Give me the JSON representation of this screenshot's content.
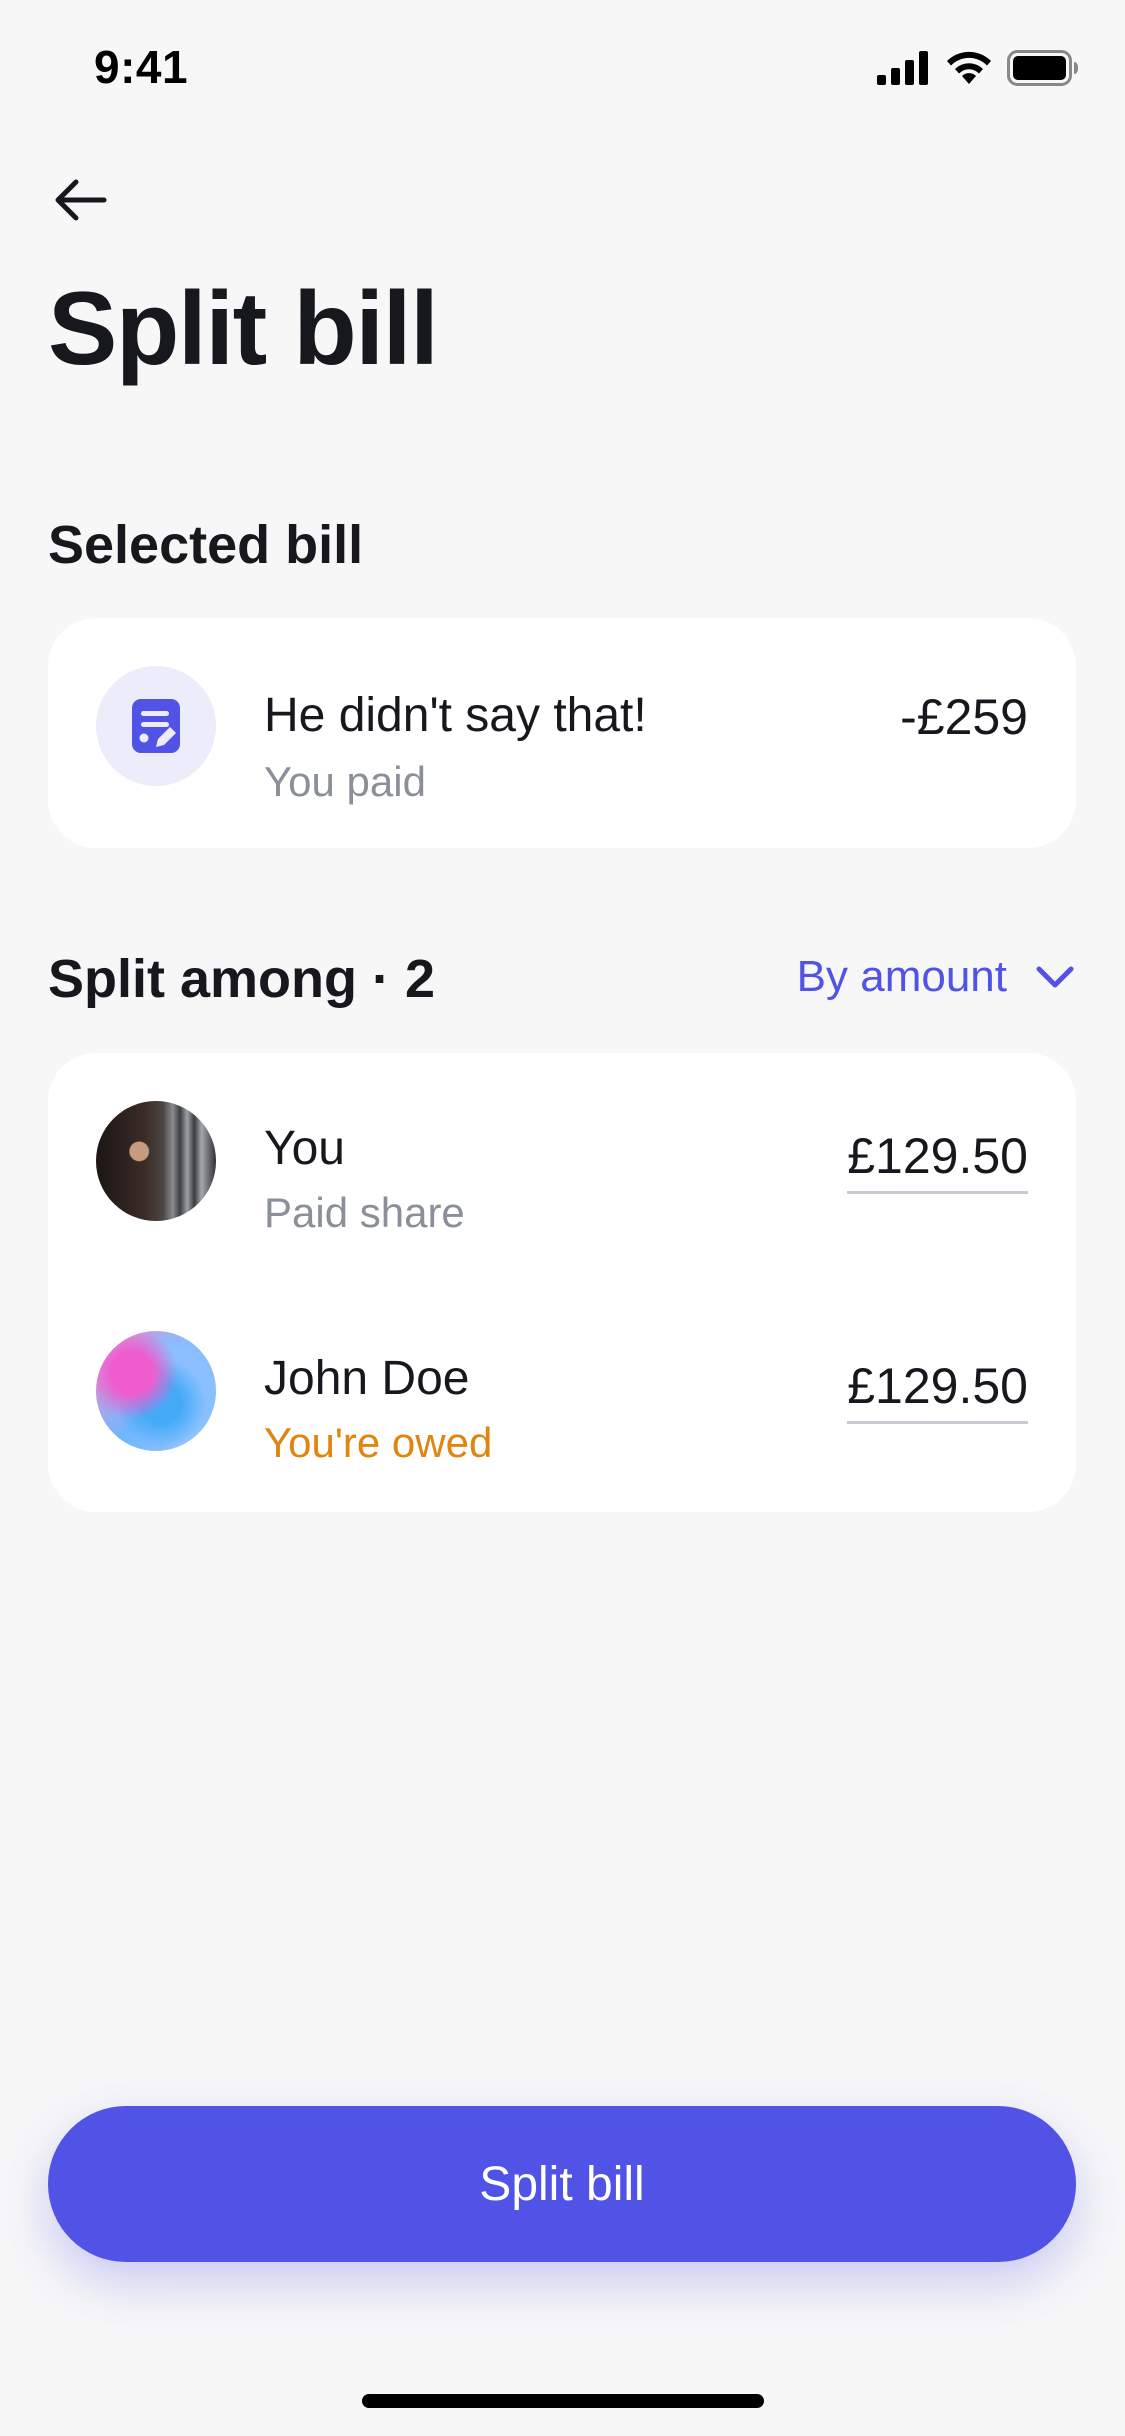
{
  "status_bar": {
    "time": "9:41",
    "icons": [
      "cellular-signal-icon",
      "wifi-icon",
      "battery-icon"
    ]
  },
  "header": {
    "back_icon": "arrow-left-icon",
    "title": "Split bill"
  },
  "selected_bill": {
    "heading": "Selected bill",
    "icon": "document-edit-icon",
    "name": "He didn't say that!",
    "subtitle": "You paid",
    "amount": "-£259"
  },
  "split_among": {
    "heading": "Split among · 2",
    "mode_label": "By amount",
    "mode_icon": "chevron-down-icon",
    "people": [
      {
        "name": "You",
        "status": "Paid share",
        "amount": "£129.50",
        "avatar": "photo"
      },
      {
        "name": "John Doe",
        "status": "You're owed",
        "amount": "£129.50",
        "avatar": "gradient"
      }
    ]
  },
  "footer": {
    "button_label": "Split bill"
  },
  "colors": {
    "accent": "#5152e6",
    "background": "#f7f7f8",
    "card": "#ffffff",
    "secondary_text": "#8a8f99",
    "owed_text": "#e0850f"
  }
}
